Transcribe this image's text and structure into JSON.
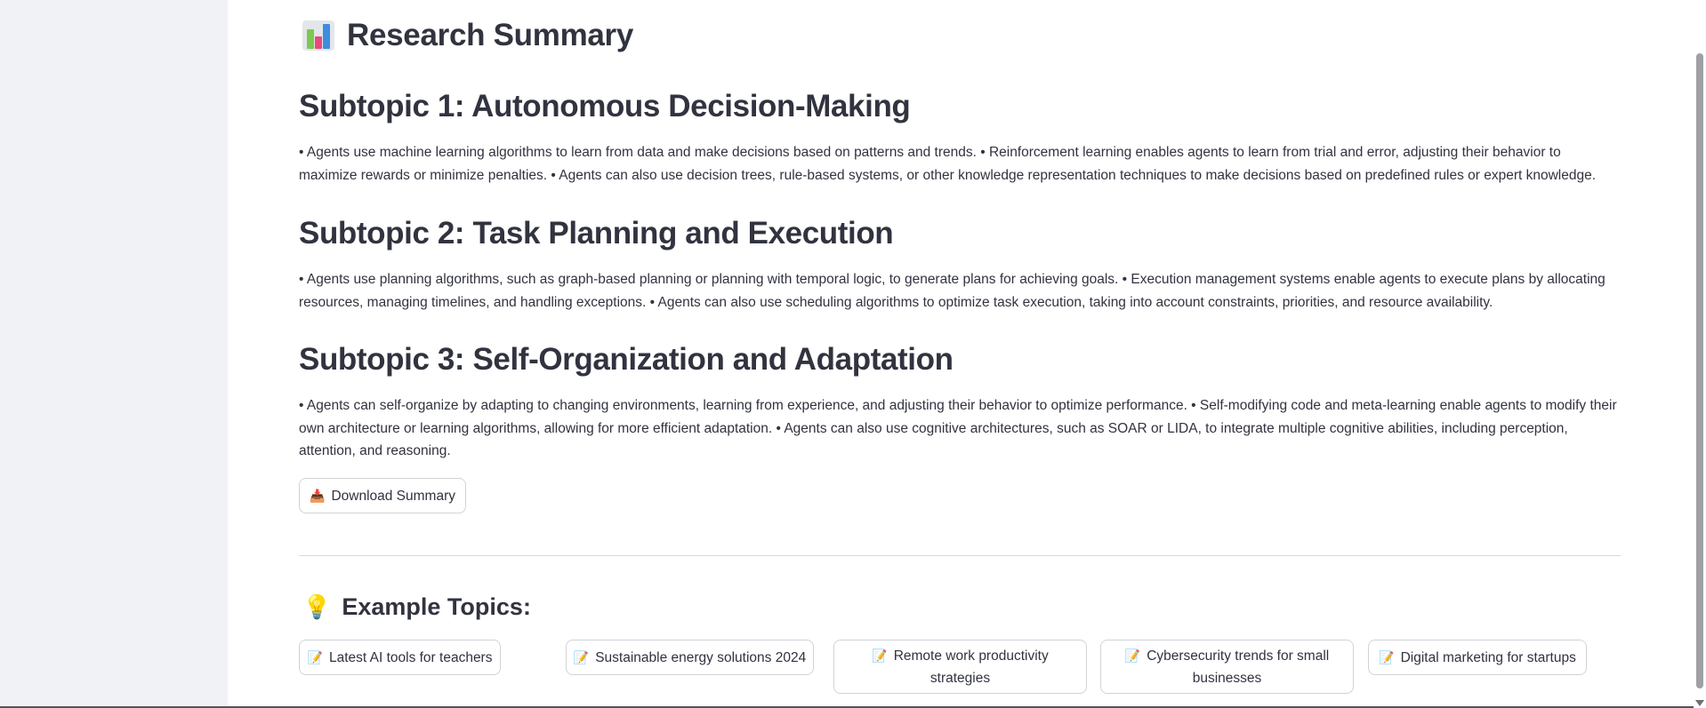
{
  "header": {
    "icon": "bar-chart-icon",
    "title": "Research Summary"
  },
  "sections": [
    {
      "heading": "Subtopic 1: Autonomous Decision-Making",
      "body": "• Agents use machine learning algorithms to learn from data and make decisions based on patterns and trends. • Reinforcement learning enables agents to learn from trial and error, adjusting their behavior to maximize rewards or minimize penalties. • Agents can also use decision trees, rule-based systems, or other knowledge representation techniques to make decisions based on predefined rules or expert knowledge."
    },
    {
      "heading": "Subtopic 2: Task Planning and Execution",
      "body": "• Agents use planning algorithms, such as graph-based planning or planning with temporal logic, to generate plans for achieving goals. • Execution management systems enable agents to execute plans by allocating resources, managing timelines, and handling exceptions. • Agents can also use scheduling algorithms to optimize task execution, taking into account constraints, priorities, and resource availability."
    },
    {
      "heading": "Subtopic 3: Self-Organization and Adaptation",
      "body": "• Agents can self-organize by adapting to changing environments, learning from experience, and adjusting their behavior to optimize performance. • Self-modifying code and meta-learning enable agents to modify their own architecture or learning algorithms, allowing for more efficient adaptation. • Agents can also use cognitive architectures, such as SOAR or LIDA, to integrate multiple cognitive abilities, including perception, attention, and reasoning."
    }
  ],
  "download_button": {
    "icon": "inbox-tray-icon",
    "label": "Download Summary"
  },
  "examples": {
    "icon": "light-bulb-icon",
    "title": "Example Topics:",
    "items": [
      {
        "icon": "memo-icon",
        "label": "Latest AI tools for teachers"
      },
      {
        "icon": "memo-icon",
        "label": "Sustainable energy solutions 2024"
      },
      {
        "icon": "memo-icon",
        "label": "Remote work productivity strategies"
      },
      {
        "icon": "memo-icon",
        "label": "Cybersecurity trends for small businesses"
      },
      {
        "icon": "memo-icon",
        "label": "Digital marketing for startups"
      }
    ]
  },
  "colors": {
    "text": "#31333f",
    "sidebar": "#f0f2f6",
    "border": "#d1d3d8"
  }
}
